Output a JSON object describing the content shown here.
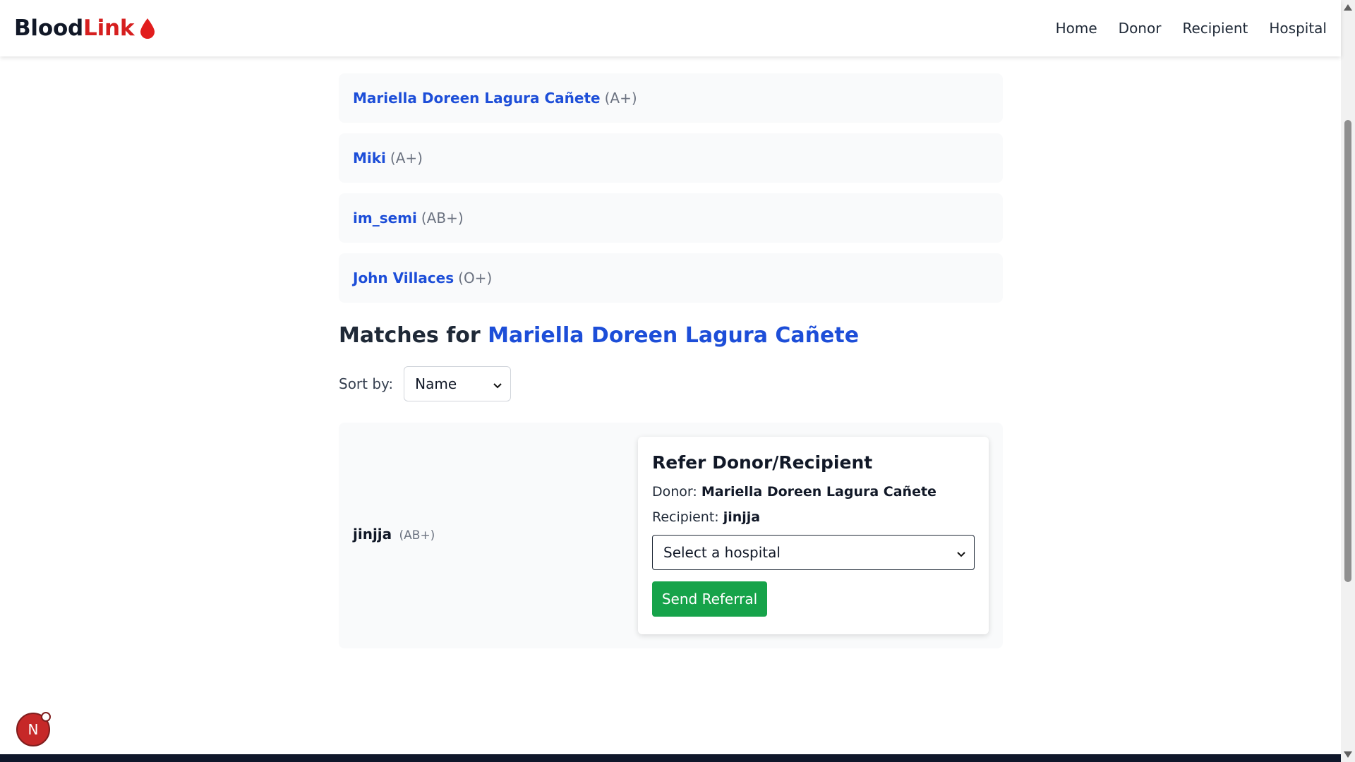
{
  "brand": {
    "part1": "Blood",
    "part2": "Link"
  },
  "nav": {
    "items": [
      "Home",
      "Donor",
      "Recipient",
      "Hospital"
    ]
  },
  "donors": [
    {
      "name": "Mariella Doreen Lagura Cañete",
      "blood_type": "(A+)"
    },
    {
      "name": "Miki",
      "blood_type": "(A+)"
    },
    {
      "name": "im_semi",
      "blood_type": "(AB+)"
    },
    {
      "name": "John Villaces",
      "blood_type": "(O+)"
    }
  ],
  "matches": {
    "title_prefix": "Matches for ",
    "selected_donor": "Mariella Doreen Lagura Cañete",
    "sort_label": "Sort by:",
    "sort_value": "Name",
    "results": [
      {
        "name": "jinjja",
        "blood_type": "(AB+)"
      }
    ]
  },
  "refer": {
    "title": "Refer Donor/Recipient",
    "donor_label": "Donor:",
    "donor_name": "Mariella Doreen Lagura Cañete",
    "recipient_label": "Recipient:",
    "recipient_name": "jinjja",
    "hospital_placeholder": "Select a hospital",
    "send_label": "Send Referral"
  },
  "badge": {
    "letter": "N"
  },
  "colors": {
    "accent": "#1d4ed8",
    "brand_red": "#d61f1f",
    "button_green": "#16a34a"
  },
  "icons": [
    "blood-drop-icon",
    "chevron-down-icon",
    "next-logo-icon"
  ]
}
